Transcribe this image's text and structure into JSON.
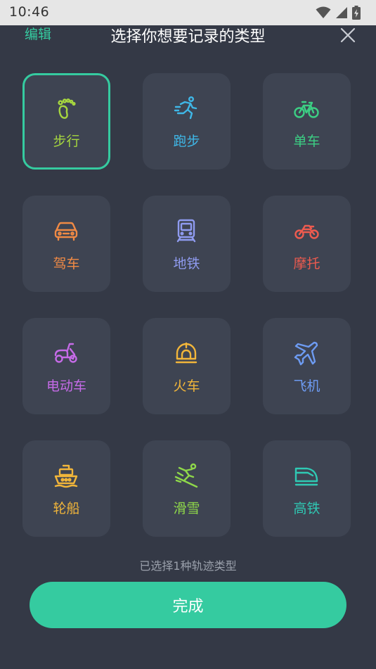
{
  "status_bar": {
    "time": "10:46"
  },
  "header": {
    "edit_label": "编辑",
    "title": "选择你想要记录的类型"
  },
  "types": [
    {
      "label": "步行",
      "icon": "footprint-icon",
      "color": "#a6d63f",
      "selected": true
    },
    {
      "label": "跑步",
      "icon": "runner-icon",
      "color": "#3fb8e8",
      "selected": false
    },
    {
      "label": "单车",
      "icon": "bicycle-icon",
      "color": "#3ccf84",
      "selected": false
    },
    {
      "label": "驾车",
      "icon": "car-icon",
      "color": "#f08a45",
      "selected": false
    },
    {
      "label": "地铁",
      "icon": "subway-icon",
      "color": "#8f9bf0",
      "selected": false
    },
    {
      "label": "摩托",
      "icon": "motorcycle-icon",
      "color": "#ee5b4f",
      "selected": false
    },
    {
      "label": "电动车",
      "icon": "scooter-icon",
      "color": "#c66be8",
      "selected": false
    },
    {
      "label": "火车",
      "icon": "train-icon",
      "color": "#f2b63a",
      "selected": false
    },
    {
      "label": "飞机",
      "icon": "airplane-icon",
      "color": "#6d9bf2",
      "selected": false
    },
    {
      "label": "轮船",
      "icon": "ship-icon",
      "color": "#f2b63a",
      "selected": false
    },
    {
      "label": "滑雪",
      "icon": "ski-icon",
      "color": "#8fd84a",
      "selected": false
    },
    {
      "label": "高铁",
      "icon": "highspeed-rail-icon",
      "color": "#2fc9b4",
      "selected": false
    }
  ],
  "hint": "已选择1种轨迹类型",
  "done_label": "完成",
  "colors": {
    "accent": "#35cba0",
    "background": "#343946",
    "card": "#3e4452"
  }
}
